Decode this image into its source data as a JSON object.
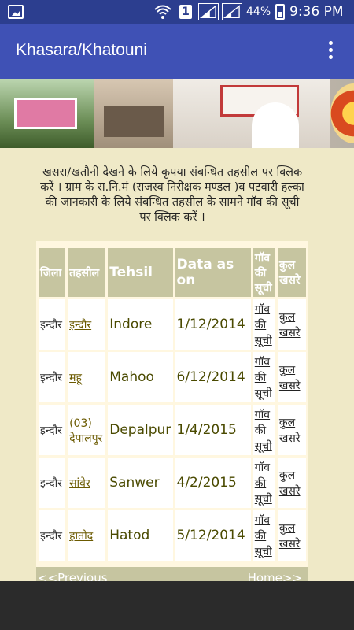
{
  "status_bar": {
    "sim_number": "1",
    "battery": "44%",
    "time": "9:36 PM",
    "icons": [
      "gallery-icon",
      "wifi-icon",
      "sim-icon",
      "signal-icon",
      "signal-icon",
      "battery-icon"
    ]
  },
  "app_bar": {
    "title": "Khasara/Khatouni",
    "menu_icon": "overflow-menu-icon"
  },
  "intro_text": "खसरा/खतौनी देखने के लिये कृपया संबन्धित तहसील पर क्लिक करें । ग्राम के रा.नि.मं (राजस्व निरीक्षक मण्डल )व पटवारी हल्का की जानकारी के लिये संबन्धित तहसील के सामने गॉव की सूची पर क्लिक करें ।",
  "table": {
    "headers": [
      "जिला",
      "तहसील",
      "Tehsil",
      "Data as on",
      "गॉव की सूची",
      "कुल खसरे"
    ],
    "rows": [
      {
        "district": "इन्दौर",
        "tehsil_hi": "इन्दौर",
        "tehsil_en": "Indore",
        "date": "1/12/2014",
        "village_list": "गॉव की सूची",
        "total": "कुल खसरे"
      },
      {
        "district": "इन्दौर",
        "tehsil_hi": "महू",
        "tehsil_en": "Mahoo",
        "date": "6/12/2014",
        "village_list": "गॉव की सूची",
        "total": "कुल खसरे"
      },
      {
        "district": "इन्दौर",
        "tehsil_hi": "(03) देपालपुर",
        "tehsil_en": "Depalpur",
        "date": "1/4/2015",
        "village_list": "गॉव की सूची",
        "total": "कुल खसरे"
      },
      {
        "district": "इन्दौर",
        "tehsil_hi": "सांवेर",
        "tehsil_en": "Sanwer",
        "date": "4/2/2015",
        "village_list": "गॉव की सूची",
        "total": "कुल खसरे"
      },
      {
        "district": "इन्दौर",
        "tehsil_hi": "हातोद",
        "tehsil_en": "Hatod",
        "date": "5/12/2014",
        "village_list": "गॉव की सूची",
        "total": "कुल खसरे"
      }
    ]
  },
  "pager": {
    "prev": "<<Previous",
    "home": "Home>>"
  }
}
